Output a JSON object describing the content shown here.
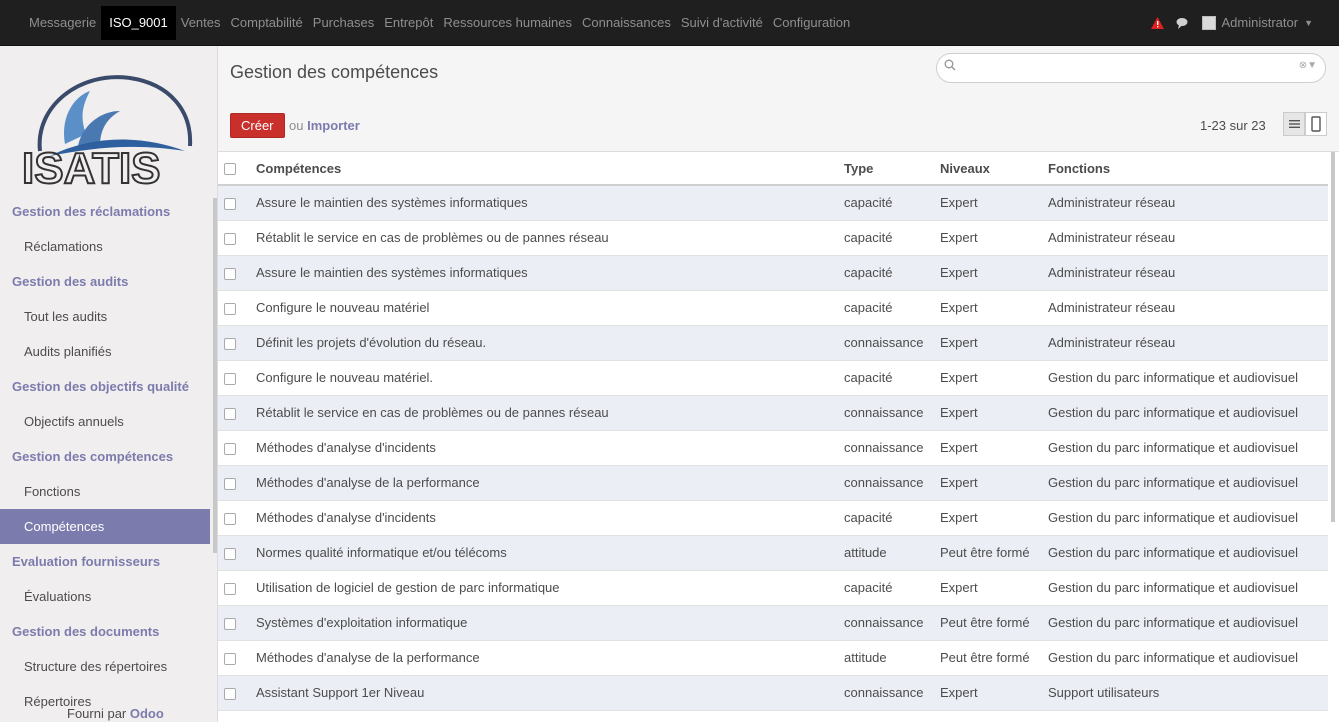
{
  "topbar": {
    "menu": [
      "Messagerie",
      "ISO_9001",
      "Ventes",
      "Comptabilité",
      "Purchases",
      "Entrepôt",
      "Ressources humaines",
      "Connaissances",
      "Suivi d'activité",
      "Configuration"
    ],
    "active_index": 1,
    "user": "Administrator"
  },
  "sidebar": {
    "logo_text": "ISATIS",
    "sections": [
      {
        "title": "Gestion des réclamations",
        "items": [
          "Réclamations"
        ]
      },
      {
        "title": "Gestion des audits",
        "items": [
          "Tout les audits",
          "Audits planifiés"
        ]
      },
      {
        "title": "Gestion des objectifs qualité",
        "items": [
          "Objectifs annuels"
        ]
      },
      {
        "title": "Gestion des compétences",
        "items": [
          "Fonctions",
          "Compétences"
        ]
      },
      {
        "title": "Evaluation fournisseurs",
        "items": [
          "Évaluations"
        ]
      },
      {
        "title": "Gestion des documents",
        "items": [
          "Structure des répertoires",
          "Répertoires"
        ]
      }
    ],
    "active_item": "Compétences",
    "powered_prefix": "Fourni par",
    "powered_brand": "Odoo"
  },
  "main": {
    "title": "Gestion des compétences",
    "search_placeholder": "",
    "create_label": "Créer",
    "or_label": "ou",
    "import_label": "Importer",
    "pager": "1-23 sur 23"
  },
  "table": {
    "columns": [
      "Compétences",
      "Type",
      "Niveaux",
      "Fonctions"
    ],
    "rows": [
      [
        "Assure le maintien des systèmes informatiques",
        "capacité",
        "Expert",
        "Administrateur réseau"
      ],
      [
        "Rétablit le service en cas de problèmes ou de pannes réseau",
        "capacité",
        "Expert",
        "Administrateur réseau"
      ],
      [
        "Assure le maintien des systèmes informatiques",
        "capacité",
        "Expert",
        "Administrateur réseau"
      ],
      [
        "Configure le nouveau matériel",
        "capacité",
        "Expert",
        "Administrateur réseau"
      ],
      [
        "Définit les projets d'évolution du réseau.",
        "connaissance",
        "Expert",
        "Administrateur réseau"
      ],
      [
        "Configure le nouveau matériel.",
        "capacité",
        "Expert",
        "Gestion du parc informatique et audiovisuel"
      ],
      [
        "Rétablit le service en cas de problèmes ou de pannes réseau",
        "connaissance",
        "Expert",
        "Gestion du parc informatique et audiovisuel"
      ],
      [
        "Méthodes d'analyse d'incidents",
        "connaissance",
        "Expert",
        "Gestion du parc informatique et audiovisuel"
      ],
      [
        "Méthodes d'analyse de la performance",
        "connaissance",
        "Expert",
        "Gestion du parc informatique et audiovisuel"
      ],
      [
        "Méthodes d'analyse d'incidents",
        "capacité",
        "Expert",
        "Gestion du parc informatique et audiovisuel"
      ],
      [
        "Normes qualité informatique et/ou télécoms",
        "attitude",
        "Peut être formé",
        "Gestion du parc informatique et audiovisuel"
      ],
      [
        "Utilisation de logiciel de gestion de parc informatique",
        "capacité",
        "Expert",
        "Gestion du parc informatique et audiovisuel"
      ],
      [
        "Systèmes d'exploitation informatique",
        "connaissance",
        "Peut être formé",
        "Gestion du parc informatique et audiovisuel"
      ],
      [
        "Méthodes d'analyse de la performance",
        "attitude",
        "Peut être formé",
        "Gestion du parc informatique et audiovisuel"
      ],
      [
        "Assistant Support 1er Niveau",
        "connaissance",
        "Expert",
        "Support utilisateurs"
      ]
    ]
  },
  "colors": {
    "accent": "#7c7bad",
    "create_button": "#c9302c",
    "topbar": "#1f1f1f",
    "row_alt": "#eceef6"
  },
  "icons": [
    "alert-icon",
    "chat-icon",
    "avatar",
    "search-icon",
    "list-view-icon",
    "form-view-icon"
  ]
}
